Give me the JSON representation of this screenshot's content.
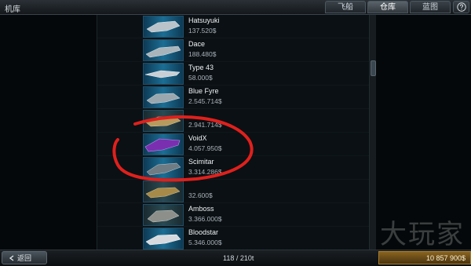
{
  "header": {
    "title": "机库",
    "tabs": [
      {
        "label": "飞船",
        "active": false
      },
      {
        "label": "仓库",
        "active": true
      },
      {
        "label": "蓝图",
        "active": false
      }
    ],
    "help_icon": "question-icon"
  },
  "ships": [
    {
      "name": "Hatsuyuki",
      "price": "137.520$"
    },
    {
      "name": "Dace",
      "price": "188.480$"
    },
    {
      "name": "Type 43",
      "price": "58.000$"
    },
    {
      "name": "Blue Fyre",
      "price": "2.545.714$"
    },
    {
      "name": "",
      "price": "2.941.714$"
    },
    {
      "name": "VoidX",
      "price": "4.057.950$"
    },
    {
      "name": "Scimitar",
      "price": "3.314.286$"
    },
    {
      "name": "",
      "price": "32.600$"
    },
    {
      "name": "Amboss",
      "price": "3.366.000$"
    },
    {
      "name": "Bloodstar",
      "price": "5.346.000$"
    }
  ],
  "footer": {
    "back_label": "返回",
    "cargo": "118 / 210t",
    "credits": "10 857 900$"
  },
  "annotation": {
    "color": "#e0201c"
  },
  "watermark": "大玩家",
  "colors": {
    "accent": "#2a8fd0",
    "credits_bg": "#7a5a1c"
  }
}
